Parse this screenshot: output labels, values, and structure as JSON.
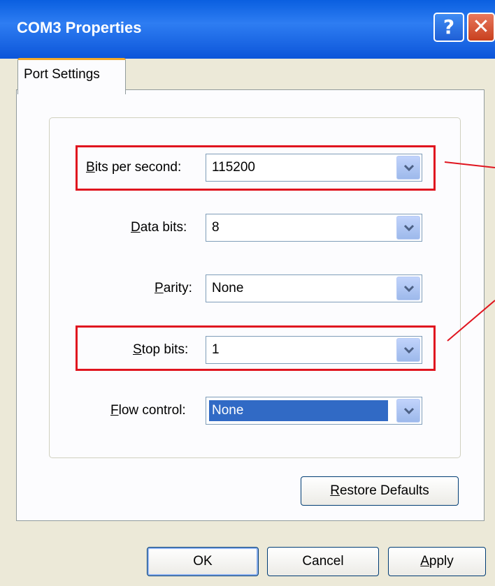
{
  "window": {
    "title": "COM3 Properties",
    "help_glyph": "?",
    "close_glyph": "✕"
  },
  "tabs": [
    {
      "label": "Port Settings",
      "active": true
    }
  ],
  "fields": [
    {
      "label_mnemonic": "B",
      "label_rest": "its per second:",
      "value": "115200"
    },
    {
      "label_mnemonic": "D",
      "label_rest": "ata bits:",
      "value": "8"
    },
    {
      "label_mnemonic": "P",
      "label_rest": "arity:",
      "value": "None"
    },
    {
      "label_mnemonic": "S",
      "label_rest": "top bits:",
      "value": "1"
    },
    {
      "label_mnemonic": "F",
      "label_rest": "low control:",
      "value": "None"
    }
  ],
  "buttons": {
    "restore_mnemonic": "R",
    "restore_rest": "estore Defaults",
    "ok": "OK",
    "cancel": "Cancel",
    "apply_mnemonic": "A",
    "apply_rest": "pply"
  },
  "colors": {
    "title_bar": "#0A5FE0",
    "highlight_box": "#E0151F",
    "selection": "#316AC5",
    "dialog_bg": "#ECE9D8"
  },
  "icons": [
    "help-icon",
    "close-icon",
    "chevron-down-icon"
  ]
}
